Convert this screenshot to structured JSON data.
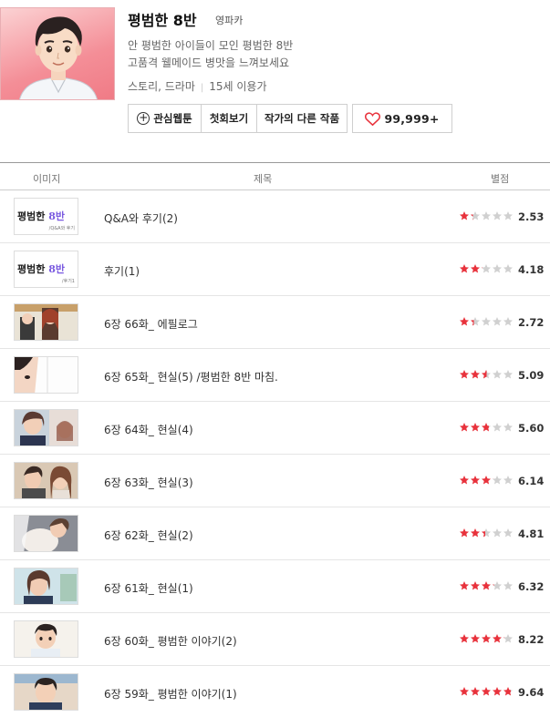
{
  "webtoon": {
    "title": "평범한 8반",
    "author": "영파카",
    "description_line1": "안 평범한 아이들이 모인 평범한 8반",
    "description_line2": "고품격 웰메이드 병맛을 느껴보세요",
    "genre": "스토리, 드라마",
    "age": "15세 이용가"
  },
  "buttons": {
    "favorite": "관심웹툰",
    "first_episode": "첫회보기",
    "other_works": "작가의 다른 작품",
    "likes": "99,999+"
  },
  "table_header": {
    "image": "이미지",
    "title": "제목",
    "rating": "별점"
  },
  "episodes": [
    {
      "title": "Q&A와 후기(2)",
      "rating": "2.53",
      "stars": 1.26,
      "thumb_text": "평범한 8반",
      "thumb_sub": "/Q&A와 후기"
    },
    {
      "title": "후기(1)",
      "rating": "4.18",
      "stars": 2.09,
      "thumb_text": "평범한 8반",
      "thumb_sub": "/후기1"
    },
    {
      "title": "6장 66화_ 에필로그",
      "rating": "2.72",
      "stars": 1.36
    },
    {
      "title": "6장 65화_ 현실(5) /평범한 8반 마침.",
      "rating": "5.09",
      "stars": 2.55
    },
    {
      "title": "6장 64화_ 현실(4)",
      "rating": "5.60",
      "stars": 2.8
    },
    {
      "title": "6장 63화_ 현실(3)",
      "rating": "6.14",
      "stars": 3.07
    },
    {
      "title": "6장 62화_ 현실(2)",
      "rating": "4.81",
      "stars": 2.4
    },
    {
      "title": "6장 61화_ 현실(1)",
      "rating": "6.32",
      "stars": 3.16
    },
    {
      "title": "6장 60화_ 평범한 이야기(2)",
      "rating": "8.22",
      "stars": 4.11
    },
    {
      "title": "6장 59화_ 평범한 이야기(1)",
      "rating": "9.64",
      "stars": 4.82
    }
  ],
  "colors": {
    "star_on": "#e8323c",
    "star_off": "#d0d0d0",
    "heart": "#e8323c"
  }
}
